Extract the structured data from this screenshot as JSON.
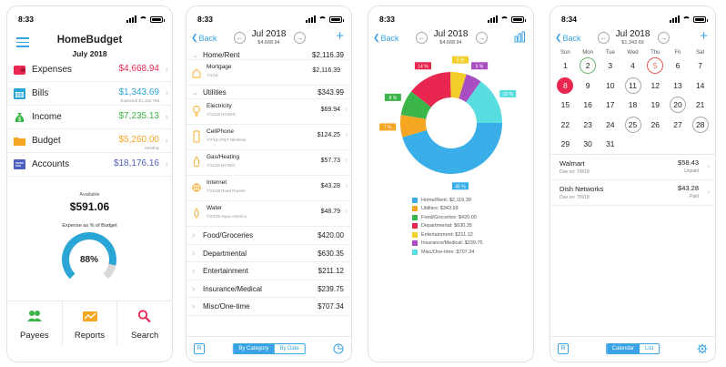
{
  "statusbar": {
    "times": [
      "8:33",
      "8:33",
      "8:33",
      "8:34"
    ]
  },
  "colors": {
    "accent": "#3aa3e3",
    "expense_red": "#e8264f",
    "income_green": "#3bb54a",
    "budget_orange": "#f5a623",
    "accounts_blue": "#2d7fd3"
  },
  "screen1": {
    "title": "HomeBudget",
    "month": "July 2018",
    "categories": [
      {
        "label": "Expenses",
        "amount": "$4,668.94",
        "note": "",
        "color": "#e8264f",
        "icon": "wallet-icon"
      },
      {
        "label": "Bills",
        "amount": "$1,343.69",
        "note": "Expected $1,192,786",
        "color": "#2aa6d6",
        "icon": "calendar-icon"
      },
      {
        "label": "Income",
        "amount": "$7,235.13",
        "note": "",
        "color": "#3bb54a",
        "icon": "money-bag-icon"
      },
      {
        "label": "Budget",
        "amount": "$5,260.00",
        "note": "Monthly",
        "color": "#f5a623",
        "icon": "folder-icon"
      },
      {
        "label": "Accounts",
        "amount": "$18,176.16",
        "note": "",
        "color": "#4c5fbf",
        "icon": "card-icon"
      }
    ],
    "available_label": "Available",
    "available_value": "$591.06",
    "expense_label": "Expense as % of Budget",
    "gauge_value": "88%",
    "gauge_fraction": 0.88,
    "tabs": [
      {
        "label": "Payees",
        "icon": "people-icon"
      },
      {
        "label": "Reports",
        "icon": "chart-icon"
      },
      {
        "label": "Search",
        "icon": "search-icon"
      }
    ]
  },
  "screen2": {
    "back": "Back",
    "month": "Jul 2018",
    "total": "$4,668.94",
    "home_rent": {
      "label": "Home/Rent",
      "amount": "$2,116.39"
    },
    "mortgage": {
      "label": "Mortgage",
      "sub": "7/1/18",
      "amount": "$2,116.39"
    },
    "utilities": {
      "label": "Utilities",
      "amount": "$343.99"
    },
    "utility_items": [
      {
        "label": "Electricity",
        "sub": "7/12/18 NYSEG",
        "amount": "$69.94",
        "icon": "bulb-icon"
      },
      {
        "label": "CellPhone",
        "sub": "7/7/18 AT&T Wireless",
        "amount": "$124.25",
        "icon": "phone-icon"
      },
      {
        "label": "Gas/Heating",
        "sub": "7/11/18 NYSEG",
        "amount": "$57.73",
        "icon": "flame-icon"
      },
      {
        "label": "Internet",
        "sub": "7/14/18 Road Runner",
        "amount": "$43.28",
        "icon": "globe-icon"
      },
      {
        "label": "Water",
        "sub": "7/23/18 Aqua America",
        "amount": "$48.79",
        "icon": "drop-icon"
      }
    ],
    "groups": [
      {
        "label": "Food/Groceries",
        "amount": "$420.00"
      },
      {
        "label": "Departmental",
        "amount": "$630.35"
      },
      {
        "label": "Entertainment",
        "amount": "$211.12"
      },
      {
        "label": "Insurance/Medical",
        "amount": "$239.75"
      },
      {
        "label": "Misc/One-time",
        "amount": "$707.34"
      }
    ],
    "footer": {
      "r": "R",
      "seg": [
        "By Category",
        "By Date"
      ]
    }
  },
  "screen3": {
    "back": "Back",
    "month": "Jul 2018",
    "total": "$4,668.94",
    "chart_data": {
      "type": "pie",
      "categories": [
        "Home/Rent",
        "Utilities",
        "Food/Groceries",
        "Departmental",
        "Entertainment",
        "Insurance/Medical",
        "Misc/One-time"
      ],
      "values": [
        45,
        7,
        8,
        14,
        5,
        5,
        15
      ],
      "labels": [
        "45 %",
        "7 %",
        "8 %",
        "14 %",
        "5 %",
        "5 %",
        "15 %"
      ],
      "colors": [
        "#3aaee9",
        "#f5a623",
        "#3bb54a",
        "#e8264f",
        "#f2cf2b",
        "#a94ec0",
        "#57dde0"
      ],
      "legend": [
        "Home/Rent: $2,116.39",
        "Utilities: $343.99",
        "Food/Groceries: $420.00",
        "Departmental: $630.35",
        "Entertainment: $211.12",
        "Insurance/Medical: $239.75",
        "Misc/One-time: $707.34"
      ]
    }
  },
  "screen4": {
    "back": "Back",
    "month": "Jul 2018",
    "total": "$1,343.69",
    "weekdays": [
      "Sun",
      "Mon",
      "Tue",
      "Wed",
      "Thu",
      "Fri",
      "Sat"
    ],
    "weeks": [
      [
        "1",
        "2",
        "3",
        "4",
        "5",
        "6",
        "7"
      ],
      [
        "8",
        "9",
        "10",
        "11",
        "12",
        "13",
        "14"
      ],
      [
        "15",
        "16",
        "17",
        "18",
        "19",
        "20",
        "21"
      ],
      [
        "22",
        "23",
        "24",
        "25",
        "26",
        "27",
        "28"
      ],
      [
        "29",
        "30",
        "31",
        "",
        "",
        "",
        ""
      ]
    ],
    "marks": {
      "0-1": "gr",
      "0-4": "rd",
      "1-0": "tdy",
      "1-3": "gy",
      "2-5": "gy",
      "3-3": "gy",
      "3-6": "gy"
    },
    "bills": [
      {
        "name": "Walmart",
        "due": "Due on: 7/8/18",
        "amount": "$58.43",
        "status": "Unpaid"
      },
      {
        "name": "Dish Networks",
        "due": "Due on: 7/6/18",
        "amount": "$43.28",
        "status": "Paid"
      }
    ],
    "footer": {
      "r": "R",
      "seg": [
        "Calendar",
        "List"
      ]
    }
  }
}
